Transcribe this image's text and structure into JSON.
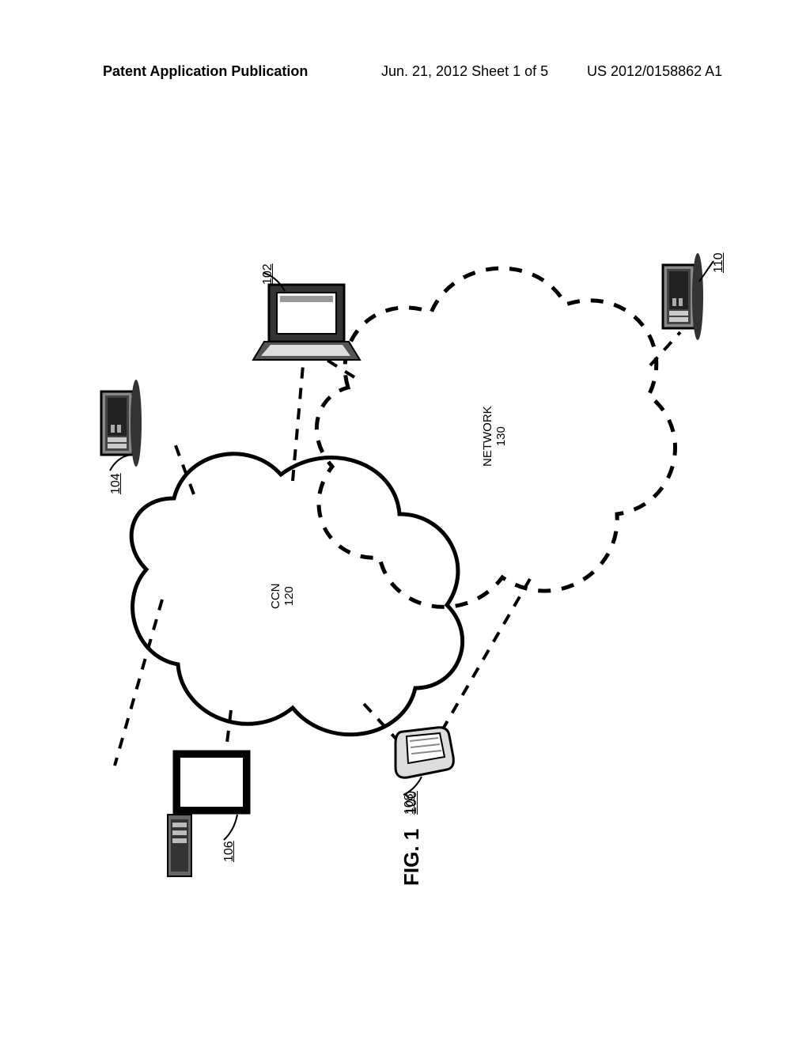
{
  "header": {
    "left": "Patent Application Publication",
    "center": "Jun. 21, 2012  Sheet 1 of 5",
    "right": "US 2012/0158862 A1"
  },
  "figure": {
    "caption": "FIG. 1",
    "overall_ref": "100",
    "ccn": {
      "label": "CCN",
      "ref": "120"
    },
    "network": {
      "label": "NETWORK",
      "ref": "130"
    },
    "devices": {
      "laptop_ref": "102",
      "server_left_ref": "104",
      "desktop_ref": "106",
      "handheld_ref": "108",
      "server_right_ref": "110"
    }
  }
}
